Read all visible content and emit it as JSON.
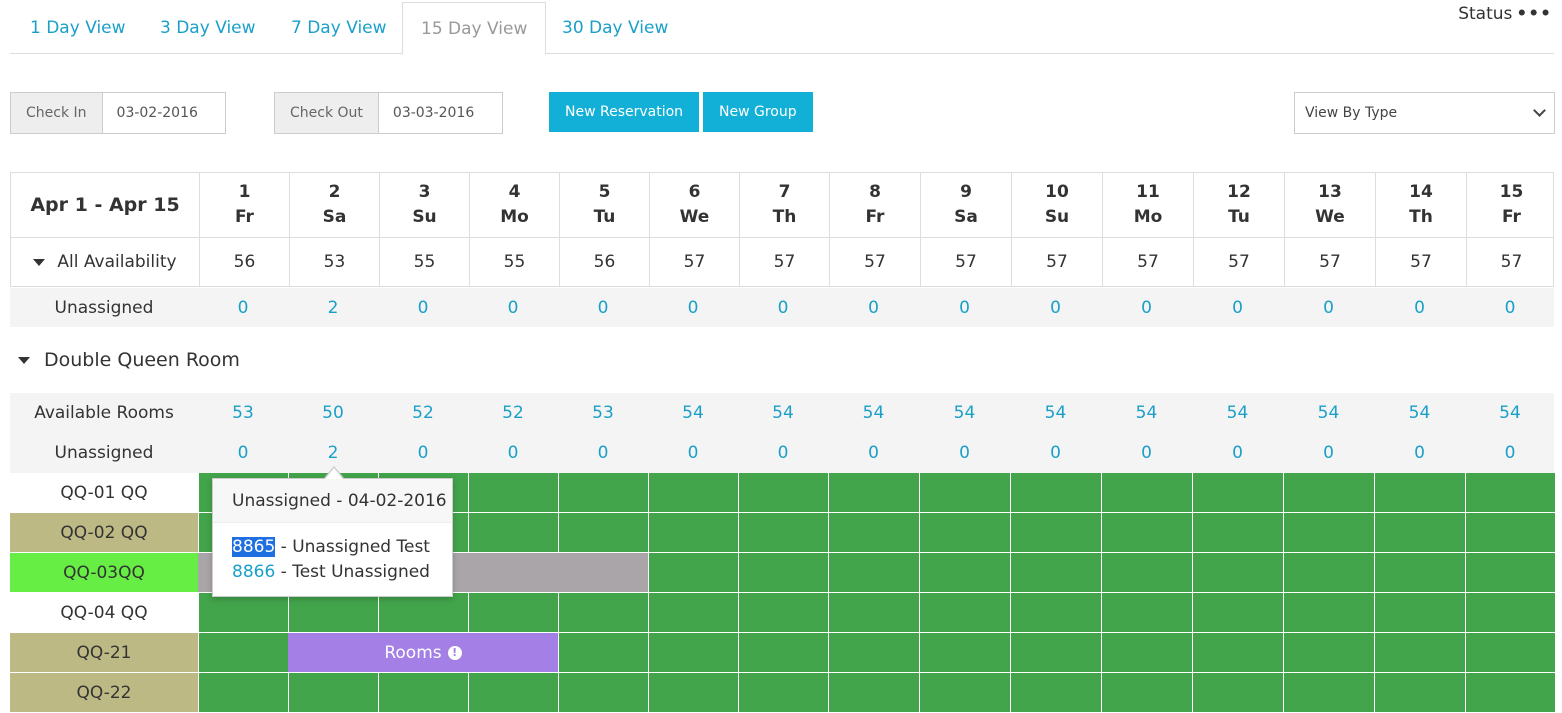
{
  "tabs": [
    {
      "label": "1 Day View"
    },
    {
      "label": "3 Day View"
    },
    {
      "label": "7 Day View"
    },
    {
      "label": "15 Day View",
      "active": true
    },
    {
      "label": "30 Day View"
    }
  ],
  "status": {
    "label": "Status",
    "more": "•••"
  },
  "check_in": {
    "label": "Check In",
    "value": "03-02-2016"
  },
  "check_out": {
    "label": "Check Out",
    "value": "03-03-2016"
  },
  "buttons": {
    "new_reservation": "New Reservation",
    "new_group": "New Group"
  },
  "view_select": {
    "value": "View By Type"
  },
  "range_label": "Apr 1 - Apr 15",
  "days": [
    {
      "num": "1",
      "dow": "Fr"
    },
    {
      "num": "2",
      "dow": "Sa"
    },
    {
      "num": "3",
      "dow": "Su"
    },
    {
      "num": "4",
      "dow": "Mo"
    },
    {
      "num": "5",
      "dow": "Tu"
    },
    {
      "num": "6",
      "dow": "We"
    },
    {
      "num": "7",
      "dow": "Th"
    },
    {
      "num": "8",
      "dow": "Fr"
    },
    {
      "num": "9",
      "dow": "Sa"
    },
    {
      "num": "10",
      "dow": "Su"
    },
    {
      "num": "11",
      "dow": "Mo"
    },
    {
      "num": "12",
      "dow": "Tu"
    },
    {
      "num": "13",
      "dow": "We"
    },
    {
      "num": "14",
      "dow": "Th"
    },
    {
      "num": "15",
      "dow": "Fr"
    }
  ],
  "all_availability": {
    "label": "All Availability",
    "values": [
      "56",
      "53",
      "55",
      "55",
      "56",
      "57",
      "57",
      "57",
      "57",
      "57",
      "57",
      "57",
      "57",
      "57",
      "57"
    ]
  },
  "unassigned_total": {
    "label": "Unassigned",
    "values": [
      "0",
      "2",
      "0",
      "0",
      "0",
      "0",
      "0",
      "0",
      "0",
      "0",
      "0",
      "0",
      "0",
      "0",
      "0"
    ]
  },
  "room_type": {
    "title": "Double Queen Room",
    "available": {
      "label": "Available Rooms",
      "values": [
        "53",
        "50",
        "52",
        "52",
        "53",
        "54",
        "54",
        "54",
        "54",
        "54",
        "54",
        "54",
        "54",
        "54",
        "54"
      ]
    },
    "unassigned": {
      "label": "Unassigned",
      "values": [
        "0",
        "2",
        "0",
        "0",
        "0",
        "0",
        "0",
        "0",
        "0",
        "0",
        "0",
        "0",
        "0",
        "0",
        "0"
      ]
    },
    "rooms": [
      {
        "name": "QQ-01 QQ",
        "color": "#ffffff"
      },
      {
        "name": "QQ-02 QQ",
        "color": "#bdb984"
      },
      {
        "name": "QQ-03QQ",
        "color": "#66ee44"
      },
      {
        "name": "QQ-04 QQ",
        "color": "#ffffff"
      },
      {
        "name": "QQ-21",
        "color": "#bdb984"
      },
      {
        "name": "QQ-22",
        "color": "#bdb984"
      }
    ]
  },
  "bars": [
    {
      "room": "QQ-03QQ",
      "label": "",
      "color": "#a9a5a8"
    },
    {
      "room": "QQ-21",
      "label": "Rooms",
      "color": "#a37fe6",
      "icon": "info-icon"
    }
  ],
  "popover": {
    "title": "Unassigned - 04-02-2016",
    "items": [
      {
        "id": "8865",
        "text": " - Unassigned Test",
        "selected": true
      },
      {
        "id": "8866",
        "text": " - Test Unassigned"
      }
    ]
  },
  "colors": {
    "accent": "#12b0d6",
    "available": "#42a44b"
  }
}
